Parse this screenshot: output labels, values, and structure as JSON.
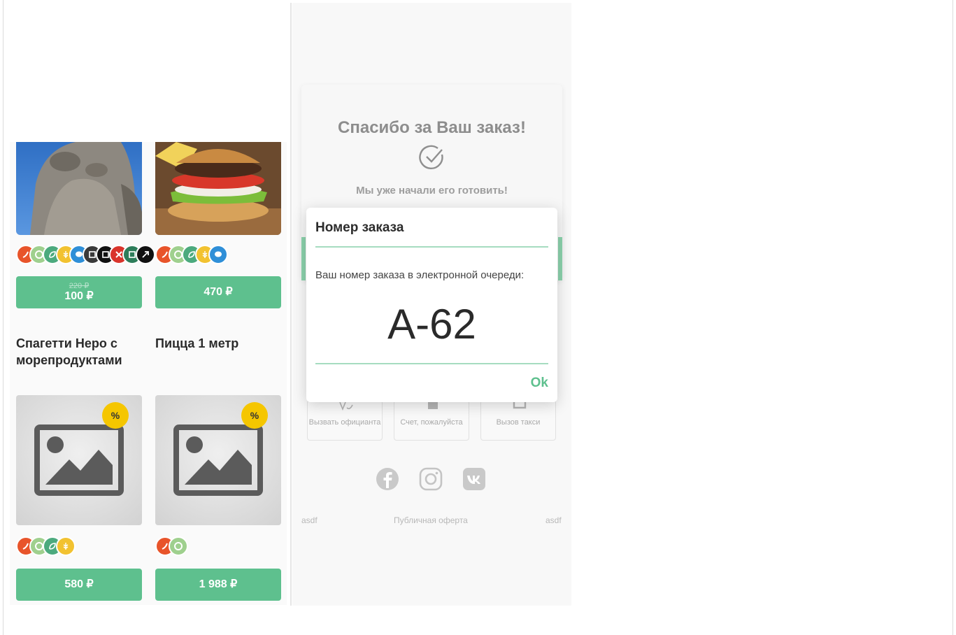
{
  "menu": {
    "products": [
      {
        "old_price": "220 ₽",
        "price": "100 ₽",
        "tags": [
          "chili-icon",
          "crescent-icon",
          "leaf-icon",
          "wheat-icon",
          "chat-icon",
          "box-icon",
          "box-icon",
          "cross-icon",
          "box-icon",
          "share-icon"
        ]
      },
      {
        "price": "470 ₽",
        "tags": [
          "chili-icon",
          "crescent-icon",
          "leaf-icon",
          "wheat-icon",
          "chat-icon"
        ]
      },
      {
        "title": "Спагетти Неро с морепродуктами",
        "badge": "%",
        "price": "580 ₽",
        "tags": [
          "chili-icon",
          "crescent-icon",
          "leaf-icon",
          "wheat-icon"
        ]
      },
      {
        "title": "Пицца 1 метр",
        "badge": "%",
        "price": "1 988 ₽",
        "tags": [
          "chili-icon",
          "crescent-icon"
        ]
      }
    ]
  },
  "thanks": {
    "title": "Спасибо за Ваш заказ!",
    "subtitle": "Мы уже начали его готовить!"
  },
  "actions": [
    {
      "label": "Вызвать официанта",
      "icon": "waiter-icon"
    },
    {
      "label": "Счет, пожалуйста",
      "icon": "bill-icon"
    },
    {
      "label": "Вызов такси",
      "icon": "taxi-icon"
    }
  ],
  "social": [
    "facebook-icon",
    "instagram-icon",
    "vk-icon"
  ],
  "footer": {
    "left": "asdf",
    "center": "Публичная оферта",
    "right": "asdf"
  },
  "modal": {
    "title": "Номер заказа",
    "text": "Ваш номер заказа в электронной очереди:",
    "order_number": "А-62",
    "ok_label": "Ok"
  },
  "colors": {
    "accent": "#5ec08e",
    "chili": "#e8542a",
    "crescent": "#9fd08e",
    "leaf": "#4caa7e",
    "wheat": "#f2c230",
    "chat": "#2f8fd8",
    "discount": "#f5c600"
  }
}
